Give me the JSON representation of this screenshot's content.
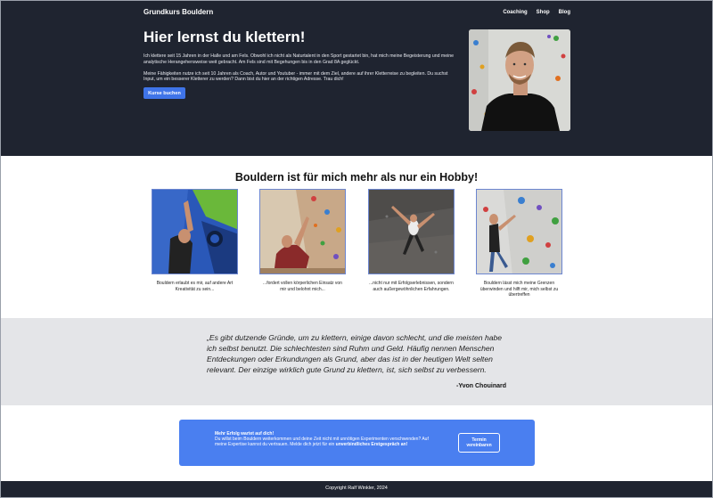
{
  "header": {
    "brand": "Grundkurs Bouldern",
    "nav": [
      "Coaching",
      "Shop",
      "Blog"
    ]
  },
  "hero": {
    "title": "Hier lernst du klettern!",
    "paragraphs": [
      "Ich klettere seit 15 Jahren in der Halle und am Fels. Obwohl ich nicht als Naturtalent in den Sport gestartet bin, hat mich meine Begeisterung und meine analytische Herangehensweise weit gebracht. Am Fels sind mit Begehungen bis in den Grad 8A geglückt.",
      "Meine Fähigkeiten nutze ich seit 10 Jahren als Coach, Autor und Youtuber - immer mit dem Ziel, andere auf ihrer Kletterreise zu begleiten. Du suchst Input, um ein besserer Kletterer zu werden? Dann bist du hier an der richtigen Adresse. Trau dich!"
    ],
    "cta_label": "Kurse buchen",
    "portrait_icon": "portrait-photo"
  },
  "intro": {
    "title": "Bouldern ist für mich mehr als nur ein Hobby!",
    "cards": [
      {
        "caption": "Bouldern erlaubt es mir, auf andere Art Kreativität zu sein...",
        "icon": "climbing-photo-1"
      },
      {
        "caption": "...fordert vollen körperlichen Einsatz von mir und belohnt mich...",
        "icon": "climbing-photo-2"
      },
      {
        "caption": "...nicht nur mit Erfolgserlebnissen, sondern auch außergewöhnlichen Erfahrungen.",
        "icon": "climbing-photo-3"
      },
      {
        "caption": "Bouldern lässt mich meine Grenzen überwinden und hilft mir, mich selbst zu übertreffen",
        "icon": "climbing-photo-4"
      }
    ]
  },
  "quote": {
    "text": "„Es gibt dutzende Gründe, um zu klettern, einige davon schlecht, und die meisten habe ich selbst benutzt. Die schlechtesten sind Ruhm und Geld. Häufig nennen Menschen Entdeckungen oder Erkundungen als Grund, aber das ist in der heutigen Welt selten relevant. Der einzige wirklich gute Grund zu klettern, ist, sich selbst zu verbessern.",
    "author": "-Yvon Chouinard"
  },
  "promo": {
    "heading": "Mehr Erfolg wartet auf dich!",
    "body": "Du willst beim Bouldern weiterkommen und deine Zeit nicht mit unnötigen Experimenten verschwenden? Auf meine Expertise kannst du vertrauen. Melde dich jetzt für ein",
    "body_strong": "unverbindliches Erstgespräch an!",
    "button_label": "Termin vereinbaren"
  },
  "footer": {
    "copyright": "Copyright Ralf Winkler, 2024"
  },
  "colors": {
    "dark": "#1f2430",
    "accent": "#3f74e8",
    "promo": "#4a7ff0",
    "quote_bg": "#e4e5e8"
  }
}
